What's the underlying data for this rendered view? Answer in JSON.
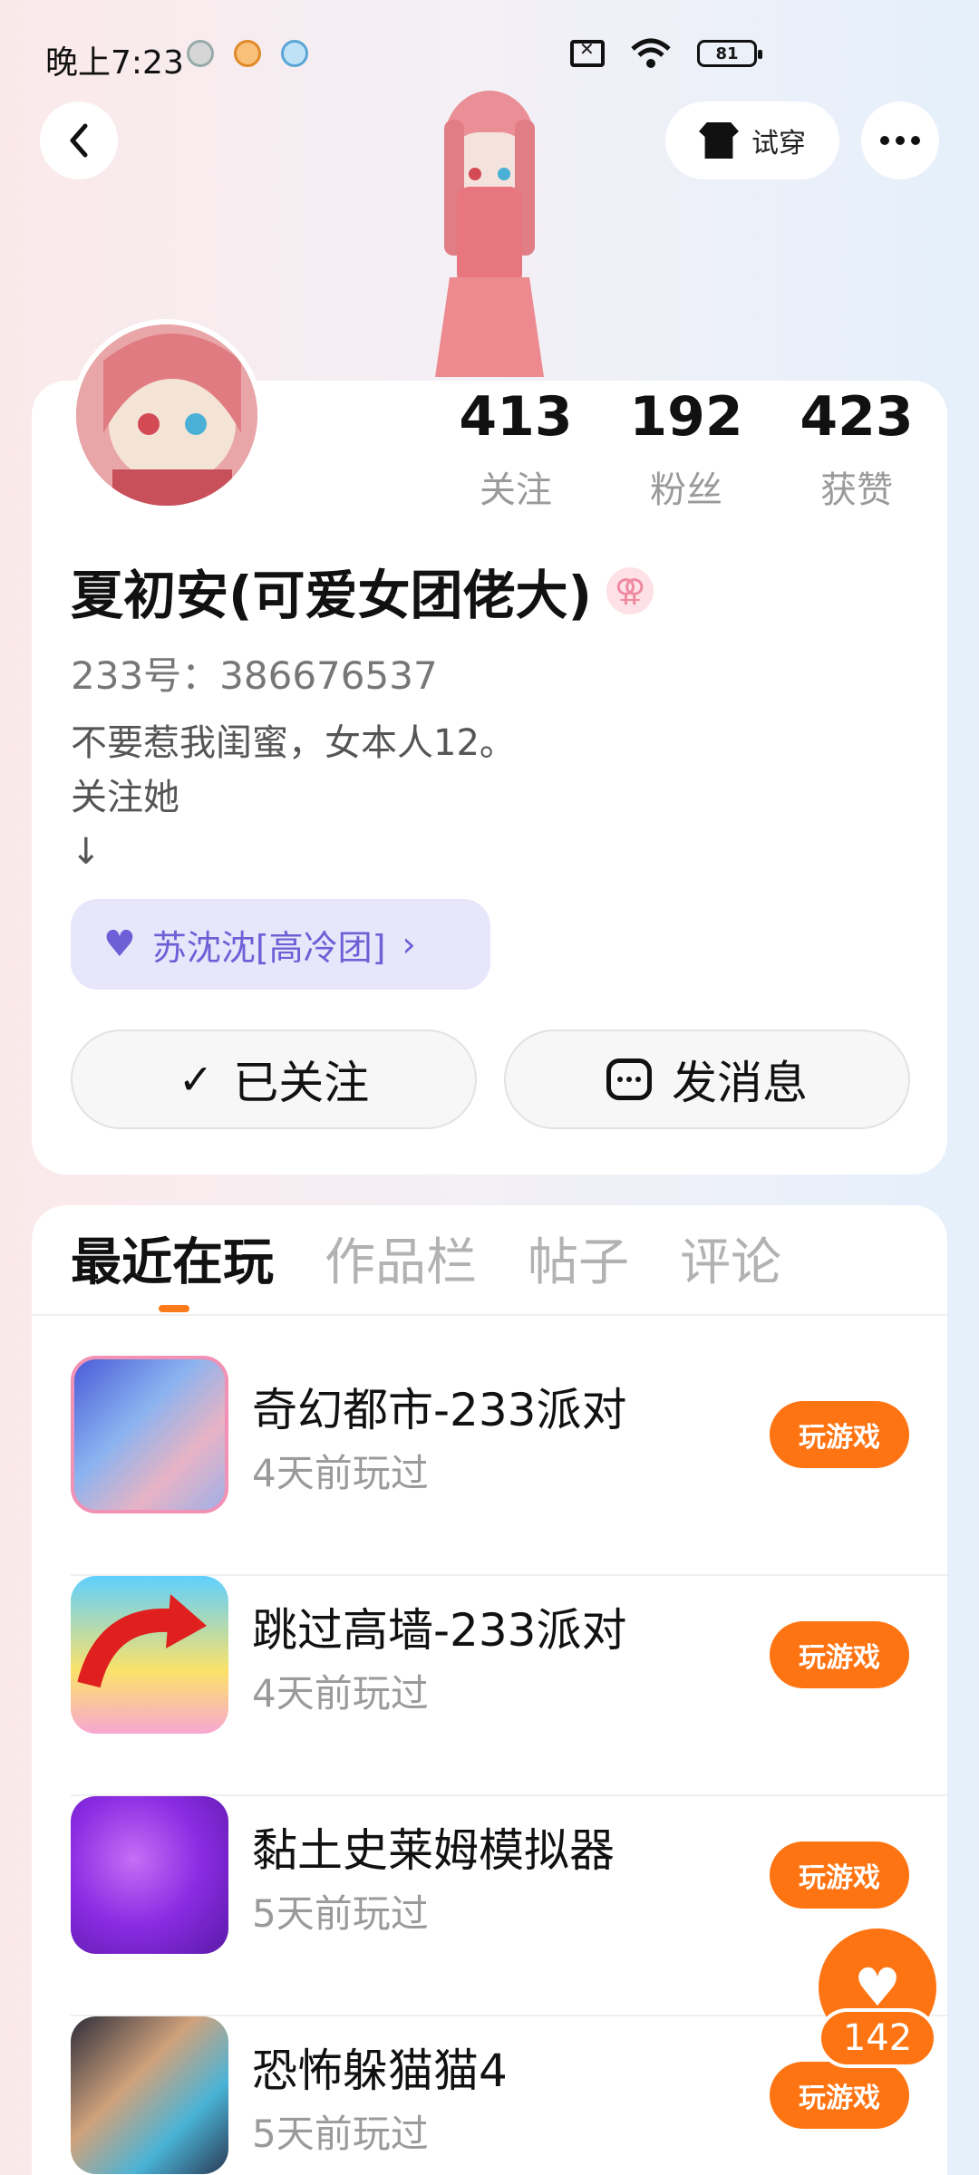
{
  "status_bar": {
    "time": "晚上7:23",
    "battery": "81",
    "icons": [
      "app-notification-icon",
      "mi-app-icon",
      "tiger-app-icon",
      "sim-icon",
      "wifi-icon",
      "battery-icon"
    ]
  },
  "header": {
    "tryon_label": "试穿"
  },
  "profile": {
    "stats": [
      {
        "value": "413",
        "label": "关注"
      },
      {
        "value": "192",
        "label": "粉丝"
      },
      {
        "value": "423",
        "label": "获赞"
      }
    ],
    "name": "夏初安(可爱女团佬大)",
    "gender_symbol": "⚢",
    "uid": "233号：386676537",
    "bio": "不要惹我闺蜜，女本人12。\n关注她\n     ↓",
    "group": "苏沈沈[高冷团]",
    "group_chevron": "›",
    "follow_label": "已关注",
    "follow_check": "✓",
    "message_label": "发消息"
  },
  "tabs": [
    "最近在玩",
    "作品栏",
    "帖子",
    "评论"
  ],
  "games": [
    {
      "title": "奇幻都市-233派对",
      "played": "4天前玩过",
      "button": "玩游戏"
    },
    {
      "title": "跳过高墙-233派对",
      "played": "4天前玩过",
      "button": "玩游戏"
    },
    {
      "title": "黏土史莱姆模拟器",
      "played": "5天前玩过",
      "button": "玩游戏"
    },
    {
      "title": "恐怖躲猫猫4",
      "played": "5天前玩过",
      "button": "玩游戏"
    }
  ],
  "float_like": {
    "heart": "♥",
    "count": "142"
  },
  "colors": {
    "accent": "#ff7412",
    "group_chip_bg": "#e7e6fb",
    "group_chip_text": "#6d5fd6"
  }
}
